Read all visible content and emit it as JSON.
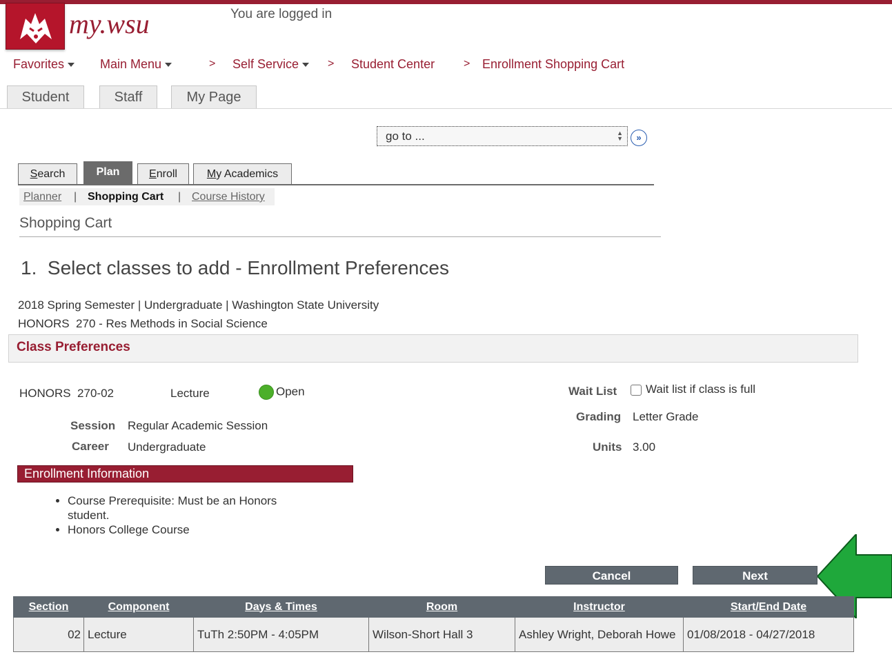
{
  "header": {
    "brand": "my.wsu",
    "logged_in_text": "You are logged in"
  },
  "breadcrumb": {
    "favorites": "Favorites",
    "main_menu": "Main Menu",
    "self_service": "Self Service",
    "student_center": "Student Center",
    "shopping_cart": "Enrollment Shopping Cart",
    "separator": ">"
  },
  "top_tabs": [
    "Student",
    "Staff",
    "My Page"
  ],
  "goto": {
    "value": "go to ...",
    "go_icon": "»"
  },
  "plan_tabs": [
    {
      "prefix": "",
      "ul": "S",
      "rest": "earch"
    },
    {
      "prefix": "",
      "ul": "",
      "rest": "Plan"
    },
    {
      "prefix": "",
      "ul": "E",
      "rest": "nroll"
    },
    {
      "prefix": "",
      "ul": "M",
      "rest": "y Academics"
    }
  ],
  "subnav": {
    "planner": "Planner",
    "shopping_cart": "Shopping Cart",
    "course_history": "Course History",
    "separator": "|"
  },
  "page_title": "Shopping Cart",
  "step_title": "1.  Select classes to add - Enrollment Preferences",
  "term_line": "2018 Spring Semester | Undergraduate | Washington State University",
  "course_line": "HONORS  270 - Res Methods in Social Science",
  "class_preferences": {
    "heading": "Class Preferences",
    "class_id": "HONORS  270-02",
    "component": "Lecture",
    "status": "Open",
    "status_color": "#4caf2a",
    "session_label": "Session",
    "session_value": "Regular Academic Session",
    "career_label": "Career",
    "career_value": "Undergraduate",
    "waitlist_label": "Wait List",
    "waitlist_text": "Wait list if class is full",
    "waitlist_checked": false,
    "grading_label": "Grading",
    "grading_value": "Letter Grade",
    "units_label": "Units",
    "units_value": "3.00"
  },
  "enrollment_info": {
    "heading": "Enrollment Information",
    "items": [
      "Course Prerequisite: Must be an Honors student.",
      "Honors College Course"
    ]
  },
  "buttons": {
    "cancel": "Cancel",
    "next": "Next"
  },
  "sections_table": {
    "headers": [
      "Section",
      "Component",
      "Days & Times",
      "Room",
      "Instructor",
      "Start/End Date"
    ],
    "rows": [
      {
        "section": "02",
        "component": "Lecture",
        "days_times": "TuTh 2:50PM - 4:05PM",
        "room": "Wilson-Short Hall 3",
        "instructor": "Ashley Wright, Deborah Howe",
        "dates": "01/08/2018 - 04/27/2018"
      }
    ]
  },
  "colors": {
    "brand_crimson": "#981e32",
    "arrow_green": "#1fa83b",
    "button_gray": "#5f6870"
  }
}
